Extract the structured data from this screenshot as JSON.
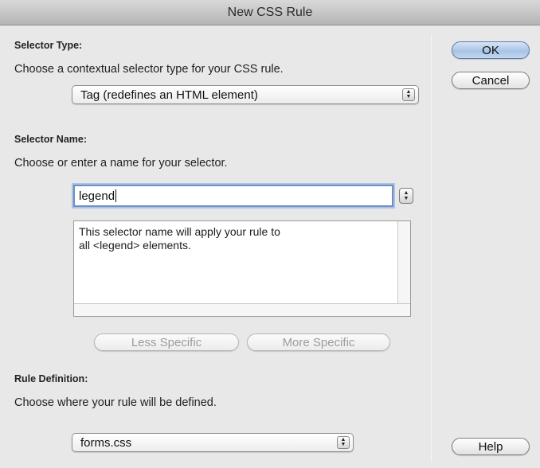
{
  "window": {
    "title": "New CSS Rule"
  },
  "selector_type": {
    "heading": "Selector Type:",
    "description": "Choose a contextual selector type for your CSS rule.",
    "selected": "Tag (redefines an HTML element)"
  },
  "selector_name": {
    "heading": "Selector Name:",
    "description": "Choose or enter a name for your selector.",
    "value": "legend",
    "info_line1": "This selector name will apply your rule to",
    "info_line2": "all <legend> elements.",
    "less_specific_label": "Less Specific",
    "more_specific_label": "More Specific"
  },
  "rule_definition": {
    "heading": "Rule Definition:",
    "description": "Choose where your rule will be defined.",
    "selected": "forms.css"
  },
  "buttons": {
    "ok_label": "OK",
    "cancel_label": "Cancel",
    "help_label": "Help"
  },
  "colors": {
    "default_button": "#a9c3e5",
    "focus_ring": "#a9c3ea",
    "dialog_bg": "#e8e8e8"
  },
  "icons": {
    "popup_arrows": "up-down-arrows-icon",
    "stepper": "stepper-arrows-icon"
  }
}
